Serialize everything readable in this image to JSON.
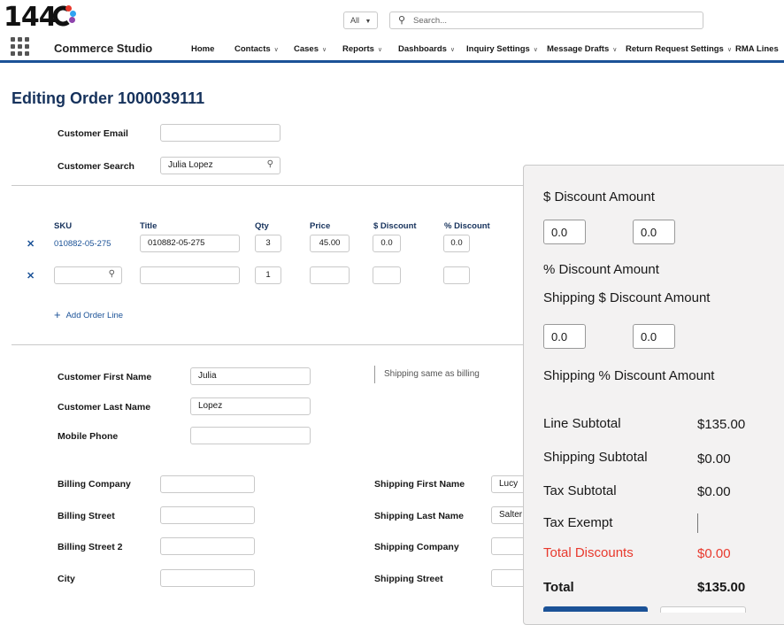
{
  "header": {
    "logo_text": "144",
    "app_name": "Commerce Studio",
    "search_scope": "All",
    "search_placeholder": "Search...",
    "nav": [
      {
        "label": "Home",
        "dropdown": false
      },
      {
        "label": "Contacts",
        "dropdown": true
      },
      {
        "label": "Cases",
        "dropdown": true
      },
      {
        "label": "Reports",
        "dropdown": true
      },
      {
        "label": "Dashboards",
        "dropdown": true
      },
      {
        "label": "Inquiry Settings",
        "dropdown": true
      },
      {
        "label": "Message Drafts",
        "dropdown": true
      },
      {
        "label": "Return Request Settings",
        "dropdown": true
      },
      {
        "label": "RMA Lines",
        "dropdown": false
      }
    ],
    "accent_color": "#1b5297"
  },
  "page": {
    "title": "Editing Order 1000039111"
  },
  "customer": {
    "email_label": "Customer Email",
    "email_value": "",
    "search_label": "Customer Search",
    "search_value": "Julia Lopez"
  },
  "order_lines": {
    "columns": [
      "SKU",
      "Title",
      "Qty",
      "Price",
      "$ Discount",
      "% Discount"
    ],
    "rows": [
      {
        "sku": "010882-05-275",
        "title": "010882-05-275",
        "qty": "3",
        "price": "45.00",
        "discount_amount": "0.0",
        "discount_percent": "0.0"
      },
      {
        "sku": "",
        "title": "",
        "qty": "1",
        "price": "",
        "discount_amount": "",
        "discount_percent": ""
      }
    ],
    "add_line_label": "Add Order Line"
  },
  "customer_info": {
    "first_name_label": "Customer First Name",
    "first_name_value": "Julia",
    "last_name_label": "Customer Last Name",
    "last_name_value": "Lopez",
    "mobile_label": "Mobile Phone",
    "mobile_value": "",
    "shipping_same_label": "Shipping same as billing"
  },
  "billing": {
    "company_label": "Billing Company",
    "street_label": "Billing Street",
    "street2_label": "Billing Street 2",
    "city_label": "City"
  },
  "shipping": {
    "first_name_label": "Shipping First Name",
    "first_name_value": "Lucy",
    "last_name_label": "Shipping Last Name",
    "last_name_value": "Salter",
    "company_label": "Shipping Company",
    "street_label": "Shipping Street"
  },
  "summary": {
    "discount_amount_label": "$ Discount Amount",
    "discount_amount_values": [
      "0.0",
      "0.0"
    ],
    "discount_percent_label": "% Discount Amount",
    "shipping_discount_amount_label": "Shipping $ Discount Amount",
    "shipping_discount_amount_values": [
      "0.0",
      "0.0"
    ],
    "shipping_discount_percent_label": "Shipping % Discount Amount",
    "line_subtotal_label": "Line Subtotal",
    "line_subtotal_value": "$135.00",
    "shipping_subtotal_label": "Shipping Subtotal",
    "shipping_subtotal_value": "$0.00",
    "tax_subtotal_label": "Tax Subtotal",
    "tax_subtotal_value": "$0.00",
    "tax_exempt_label": "Tax Exempt",
    "total_discounts_label": "Total Discounts",
    "total_discounts_value": "$0.00",
    "total_label": "Total",
    "total_value": "$135.00",
    "discount_color": "#e8392d"
  }
}
